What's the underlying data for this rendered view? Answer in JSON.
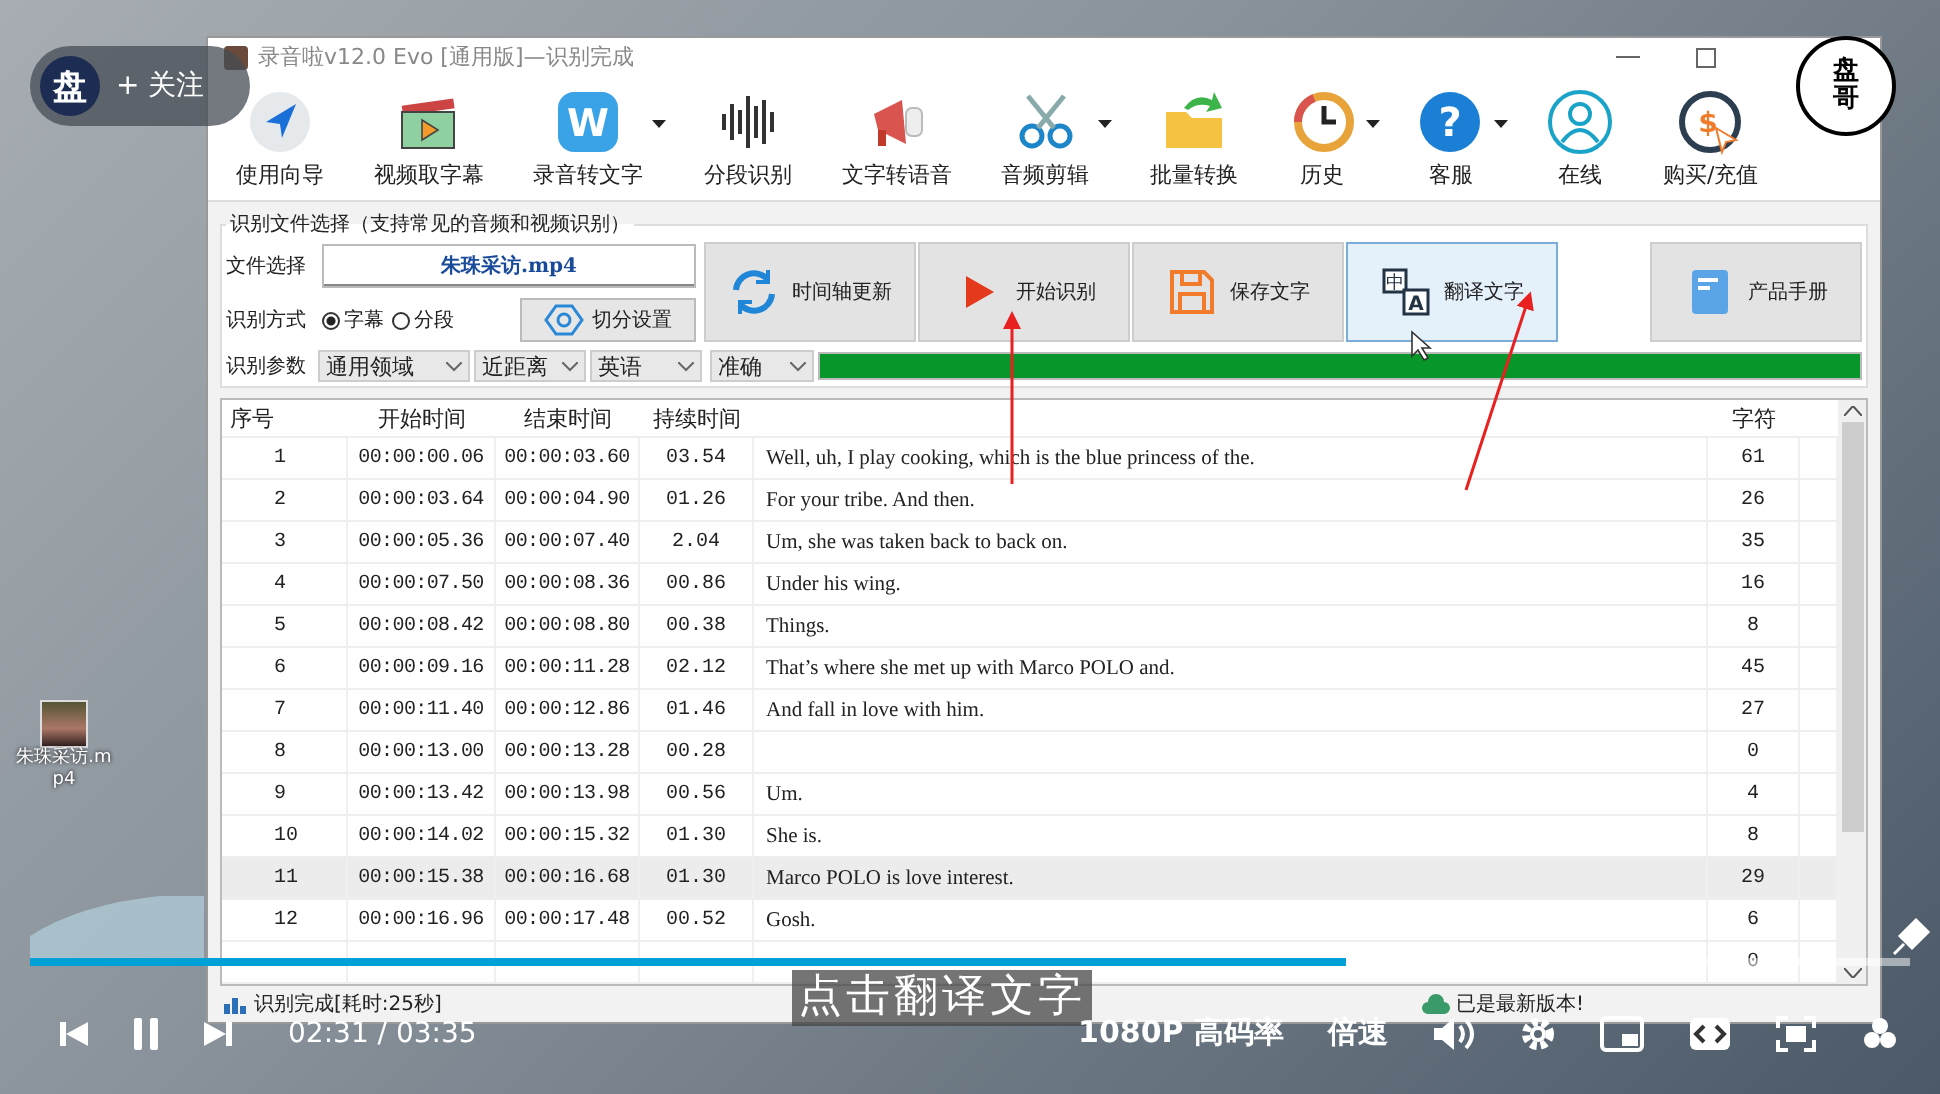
{
  "uploader": {
    "avatar_text": "盘",
    "follow_label": "+ 关注"
  },
  "channel_logo": "盘哥",
  "desktop_file": {
    "label": "朱珠采访.mp4"
  },
  "window": {
    "title": "录音啦v12.0 Evo [通用版]—识别完成"
  },
  "toolbar": [
    {
      "label": "使用向导",
      "dropdown": false
    },
    {
      "label": "视频取字幕",
      "dropdown": false
    },
    {
      "label": "录音转文字",
      "dropdown": true,
      "icon_text": "W"
    },
    {
      "label": "分段识别",
      "dropdown": false
    },
    {
      "label": "文字转语音",
      "dropdown": false
    },
    {
      "label": "音频剪辑",
      "dropdown": true
    },
    {
      "label": "批量转换",
      "dropdown": false
    },
    {
      "label": "历史",
      "dropdown": true
    },
    {
      "label": "客服",
      "dropdown": true,
      "icon_text": "?"
    },
    {
      "label": "在线",
      "dropdown": false
    },
    {
      "label": "购买/充值",
      "dropdown": false,
      "icon_text": "$"
    }
  ],
  "file_group": {
    "title": "识别文件选择（支持常见的音频和视频识别）",
    "file_label": "文件选择",
    "file_value": "朱珠采访.mp4",
    "mode_label": "识别方式",
    "modes": [
      {
        "label": "字幕",
        "selected": true
      },
      {
        "label": "分段",
        "selected": false
      }
    ],
    "split_button": "切分设置",
    "params_label": "识别参数",
    "params": [
      "通用领域",
      "近距离",
      "英语",
      "准确"
    ],
    "progress": {
      "level": 1.0
    }
  },
  "actions": [
    {
      "label": "时间轴更新",
      "hovered": false
    },
    {
      "label": "开始识别",
      "hovered": false
    },
    {
      "label": "保存文字",
      "hovered": false
    },
    {
      "label": "翻译文字",
      "hovered": true,
      "icon_texts": [
        "中",
        "A"
      ]
    },
    {
      "label": "产品手册",
      "hovered": false
    }
  ],
  "table": {
    "columns": [
      "序号",
      "开始时间",
      "结束时间",
      "持续时间",
      "",
      "字符"
    ],
    "rows": [
      {
        "no": "1",
        "start": "00:00:00.06",
        "end": "00:00:03.60",
        "duration": "03.54",
        "text": "Well, uh, I play cooking, which is the blue princess of the.",
        "chars": "61",
        "selected": false
      },
      {
        "no": "2",
        "start": "00:00:03.64",
        "end": "00:00:04.90",
        "duration": "01.26",
        "text": "For your tribe. And then.",
        "chars": "26",
        "selected": false
      },
      {
        "no": "3",
        "start": "00:00:05.36",
        "end": "00:00:07.40",
        "duration": "2.04",
        "text": "Um, she was taken back to back on.",
        "chars": "35",
        "selected": false
      },
      {
        "no": "4",
        "start": "00:00:07.50",
        "end": "00:00:08.36",
        "duration": "00.86",
        "text": "Under his wing.",
        "chars": "16",
        "selected": false
      },
      {
        "no": "5",
        "start": "00:00:08.42",
        "end": "00:00:08.80",
        "duration": "00.38",
        "text": "Things.",
        "chars": "8",
        "selected": false
      },
      {
        "no": "6",
        "start": "00:00:09.16",
        "end": "00:00:11.28",
        "duration": "02.12",
        "text": "That’s where she met up with Marco POLO and.",
        "chars": "45",
        "selected": false
      },
      {
        "no": "7",
        "start": "00:00:11.40",
        "end": "00:00:12.86",
        "duration": "01.46",
        "text": "And fall in love with him.",
        "chars": "27",
        "selected": false
      },
      {
        "no": "8",
        "start": "00:00:13.00",
        "end": "00:00:13.28",
        "duration": "00.28",
        "text": "",
        "chars": "0",
        "selected": false
      },
      {
        "no": "9",
        "start": "00:00:13.42",
        "end": "00:00:13.98",
        "duration": "00.56",
        "text": "Um.",
        "chars": "4",
        "selected": false
      },
      {
        "no": "10",
        "start": "00:00:14.02",
        "end": "00:00:15.32",
        "duration": "01.30",
        "text": "She is.",
        "chars": "8",
        "selected": false
      },
      {
        "no": "11",
        "start": "00:00:15.38",
        "end": "00:00:16.68",
        "duration": "01.30",
        "text": "Marco POLO is love interest.",
        "chars": "29",
        "selected": true
      },
      {
        "no": "12",
        "start": "00:00:16.96",
        "end": "00:00:17.48",
        "duration": "00.52",
        "text": "Gosh.",
        "chars": "6",
        "selected": false
      },
      {
        "chars": "0",
        "selected": false
      }
    ]
  },
  "status_bar": {
    "left": "识别完成[耗时:25秒]",
    "right": "已是最新版本!"
  },
  "player": {
    "subtitle": "点击翻译文字",
    "progress": {
      "level": 0.7
    },
    "current_time": "02:31",
    "separator": "/",
    "total_time": "03:35",
    "quality": "1080P 高码率",
    "speed": "倍速"
  }
}
